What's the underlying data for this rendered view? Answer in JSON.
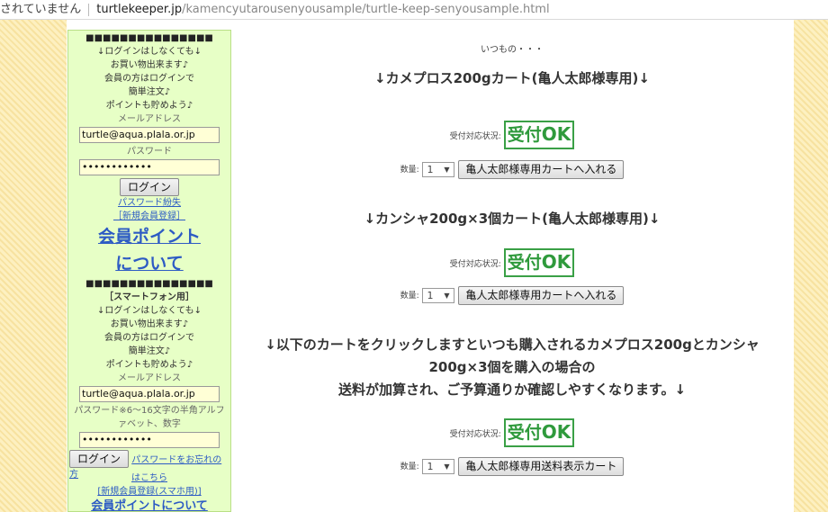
{
  "address_bar": {
    "security_text": "されていません",
    "host": "turtlekeeper.jp",
    "path": "/kamencyutarousenyousample/turtle-keep-senyousample.html"
  },
  "sidebar": {
    "dots": "■■■■■■■■■■■■■■■",
    "pc_login": {
      "lines": [
        "↓ログインはしなくても↓",
        "お買い物出来ます♪",
        "会員の方はログインで",
        "簡単注文♪",
        "ポイントも貯めよう♪"
      ],
      "email_label": "メールアドレス",
      "email_value": "turtle@aqua.plala.or.jp",
      "password_label": "パスワード",
      "password_value": "••••••••••••",
      "login_button": "ログイン",
      "forgot_link": "パスワード紛失",
      "register_link": "［新規会員登録］",
      "points_line1": "会員ポイント",
      "points_line2": "について"
    },
    "sp_login": {
      "heading": "［スマートフォン用］",
      "lines": [
        "↓ログインはしなくても↓",
        "お買い物出来ます♪",
        "会員の方はログインで",
        "簡単注文♪",
        "ポイントも貯めよう♪"
      ],
      "email_label": "メールアドレス",
      "email_value": "turtle@aqua.plala.or.jp",
      "password_label_1": "パスワード※6～16文字の半角アルフ",
      "password_label_2": "ァベット、数字",
      "password_value": "••••••••••••",
      "login_button": "ログイン",
      "forgot_link_1": "パスワードをお忘れの方",
      "forgot_link_2": "はこちら",
      "register_link": "[新規会員登録(スマホ用)]",
      "points_link": "会員ポイントについて"
    }
  },
  "main": {
    "note": "いつもの・・・",
    "sections": [
      {
        "title": "↓カメプロス200gカート(亀人太郎様専用)↓",
        "status_label": "受付対応状況:",
        "status_jp": "受付",
        "status_ok": "OK",
        "qty_label": "数量:",
        "qty_value": "1",
        "cart_button": "亀人太郎様専用カートへ入れる"
      },
      {
        "title": "↓カンシャ200g×3個カート(亀人太郎様専用)↓",
        "status_label": "受付対応状況:",
        "status_jp": "受付",
        "status_ok": "OK",
        "qty_label": "数量:",
        "qty_value": "1",
        "cart_button": "亀人太郎様専用カートへ入れる"
      },
      {
        "title_line1": "↓以下のカートをクリックしますといつも購入されるカメプロス200gとカンシャ",
        "title_line2": "200g×3個を購入の場合の",
        "title_line3": "送料が加算され、ご予算通りか確認しやすくなります。↓",
        "status_label": "受付対応状況:",
        "status_jp": "受付",
        "status_ok": "OK",
        "qty_label": "数量:",
        "qty_value": "1",
        "cart_button": "亀人太郎様専用送料表示カート"
      }
    ]
  },
  "colors": {
    "sidebar_bg": "#e7ffc6",
    "ok_green": "#2f9a3c",
    "link_blue": "#2d5bc4",
    "stripe": "#f7e2a0"
  }
}
